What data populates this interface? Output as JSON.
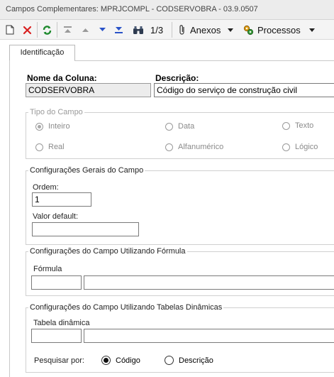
{
  "window": {
    "title": "Campos Complementares: MPRJCOMPL - CODSERVOBRA - 03.9.0507"
  },
  "toolbar": {
    "icons": [
      "new-icon",
      "delete-icon",
      "refresh-icon",
      "first-record-icon",
      "previous-record-icon",
      "next-record-icon",
      "last-record-icon",
      "binoculars-icon"
    ],
    "record_position": "1/3",
    "anexos_label": "Anexos",
    "processos_label": "Processos"
  },
  "tabs": [
    {
      "label": "Identificação",
      "active": true
    }
  ],
  "form": {
    "nome_coluna_label": "Nome da Coluna:",
    "nome_coluna_value": "CODSERVOBRA",
    "descricao_label": "Descrição:",
    "descricao_value": "Código do serviço de construção civil",
    "tipo_campo": {
      "legend": "Tipo do Campo",
      "options": [
        "Inteiro",
        "Data",
        "Texto",
        "Real",
        "Alfanumérico",
        "Lógico"
      ],
      "selected": "Inteiro"
    },
    "config_gerais": {
      "legend": "Configurações Gerais do Campo",
      "ordem_label": "Ordem:",
      "ordem_value": "1",
      "valor_default_label": "Valor default:",
      "valor_default_value": ""
    },
    "config_formula": {
      "legend": "Configurações do Campo Utilizando Fórmula",
      "formula_label": "Fórmula",
      "formula_code": "",
      "formula_desc": ""
    },
    "config_tabelas": {
      "legend": "Configurações do Campo Utilizando Tabelas Dinâmicas",
      "tabela_label": "Tabela dinâmica",
      "tabela_code": "",
      "tabela_desc": "",
      "pesquisar_label": "Pesquisar por:",
      "pesquisar_options": [
        "Código",
        "Descrição"
      ],
      "pesquisar_selected": "Código"
    }
  }
}
